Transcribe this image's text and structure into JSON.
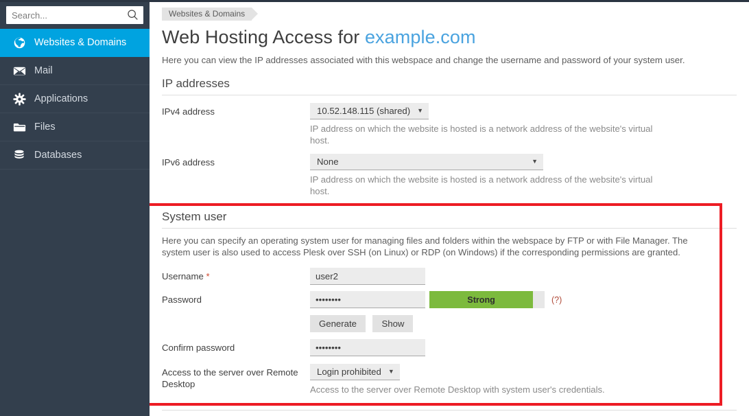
{
  "sidebar": {
    "search": {
      "placeholder": "Search...",
      "value": "",
      "icon": "search-icon"
    },
    "items": [
      {
        "label": "Websites & Domains",
        "icon": "globe-icon",
        "active": true
      },
      {
        "label": "Mail",
        "icon": "envelope-icon",
        "active": false
      },
      {
        "label": "Applications",
        "icon": "gear-icon",
        "active": false
      },
      {
        "label": "Files",
        "icon": "folder-icon",
        "active": false
      },
      {
        "label": "Databases",
        "icon": "database-icon",
        "active": false
      }
    ]
  },
  "breadcrumb": {
    "label": "Websites & Domains"
  },
  "page": {
    "title_prefix": "Web Hosting Access for ",
    "title_domain": "example.com",
    "description": "Here you can view the IP addresses associated with this webspace and change the username and password of your system user."
  },
  "ip_section": {
    "title": "IP addresses",
    "ipv4": {
      "label": "IPv4 address",
      "value": "10.52.148.115 (shared)",
      "hint": "IP address on which the website is hosted is a network address of the website's virtual host."
    },
    "ipv6": {
      "label": "IPv6 address",
      "value": "None",
      "hint": "IP address on which the website is hosted is a network address of the website's virtual host."
    }
  },
  "system_user": {
    "title": "System user",
    "description": "Here you can specify an operating system user for managing files and folders within the webspace by FTP or with File Manager. The system user is also used to access Plesk over SSH (on Linux) or RDP (on Windows) if the corresponding permissions are granted.",
    "username": {
      "label": "Username",
      "required_marker": "*",
      "value": "user2"
    },
    "password": {
      "label": "Password",
      "value": "••••••••",
      "strength_label": "Strong",
      "strength_percent": 90,
      "help_label": "(?)"
    },
    "generate_button": "Generate",
    "show_button": "Show",
    "confirm_password": {
      "label": "Confirm password",
      "value": "••••••••"
    },
    "remote_desktop": {
      "label": "Access to the server over Remote Desktop",
      "value": "Login prohibited",
      "hint": "Access to the server over Remote Desktop with system user's credentials."
    }
  },
  "colors": {
    "sidebar_bg": "#333f4d",
    "sidebar_active": "#00a3e0",
    "link": "#4aa3df",
    "strength_green": "#7cba3d",
    "highlight_red": "#ed1c24",
    "required_red": "#d0452c"
  }
}
